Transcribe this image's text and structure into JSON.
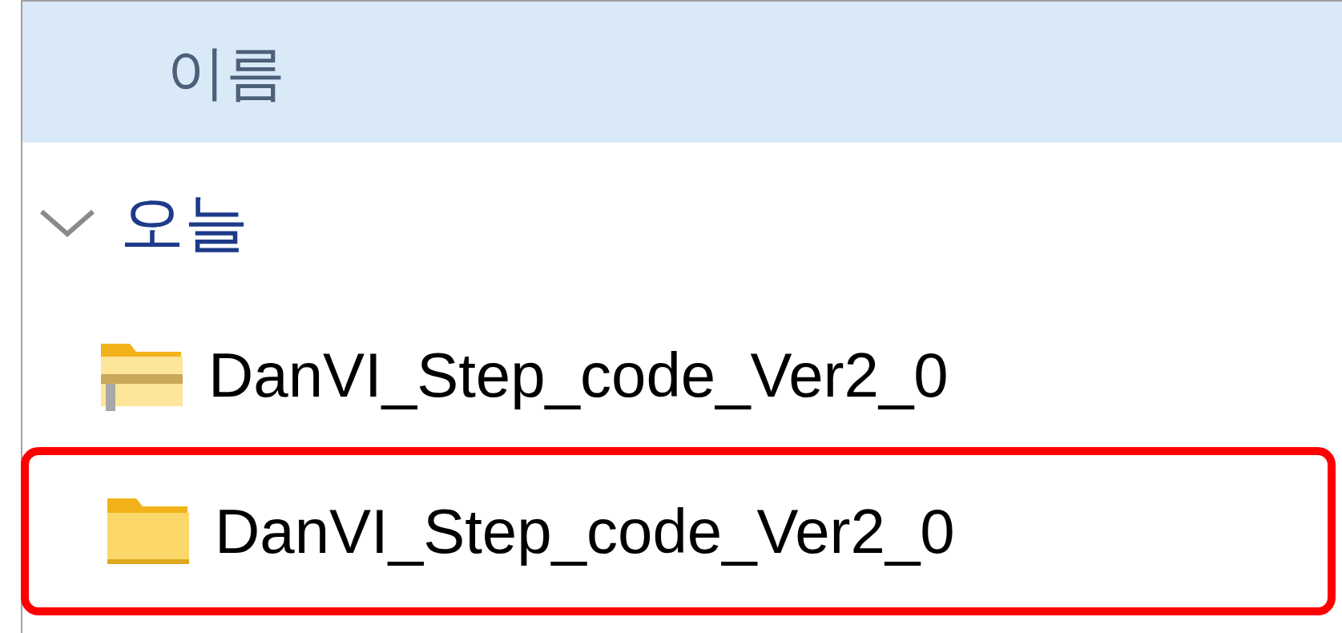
{
  "columns": [
    {
      "label": "이름"
    }
  ],
  "group": {
    "label": "오늘",
    "expanded": true,
    "items": [
      {
        "name": "DanVI_Step_code_Ver2_0",
        "kind": "zip",
        "highlighted": false
      },
      {
        "name": "DanVI_Step_code_Ver2_0",
        "kind": "folder",
        "highlighted": true
      }
    ]
  }
}
